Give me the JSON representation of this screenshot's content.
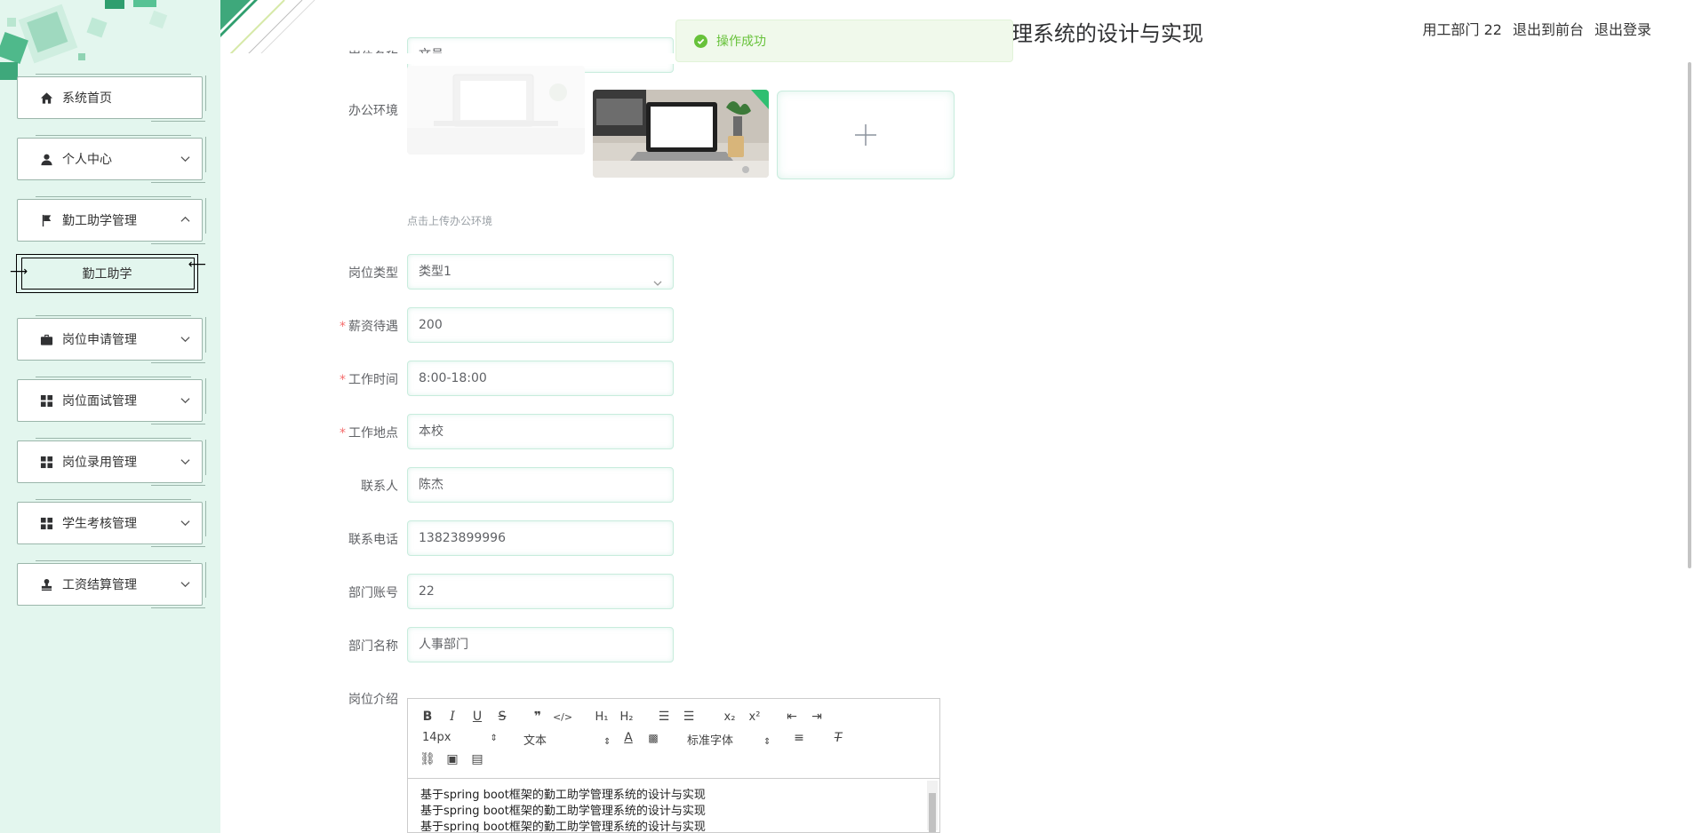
{
  "header": {
    "title": "理系统的设计与实现",
    "user": "用工部门 22",
    "to_front": "退出到前台",
    "logout": "退出登录"
  },
  "toast": {
    "message": "操作成功"
  },
  "sidebar": {
    "items": [
      {
        "label": "系统首页",
        "icon": "home-icon"
      },
      {
        "label": "个人中心",
        "icon": "user-icon"
      },
      {
        "label": "勤工助学管理",
        "icon": "flag-icon"
      },
      {
        "label": "岗位申请管理",
        "icon": "briefcase-icon"
      },
      {
        "label": "岗位面试管理",
        "icon": "grid-icon"
      },
      {
        "label": "岗位录用管理",
        "icon": "grid-icon"
      },
      {
        "label": "学生考核管理",
        "icon": "grid-icon"
      },
      {
        "label": "工资结算管理",
        "icon": "stamp-icon"
      }
    ],
    "submenu_label": "勤工助学"
  },
  "form": {
    "partial_label": "岗位名称",
    "partial_value": "文员",
    "env_label": "办公环境",
    "upload_tip": "点击上传办公环境",
    "job_type": {
      "label": "岗位类型",
      "value": "类型1"
    },
    "salary": {
      "label": "薪资待遇",
      "value": "200"
    },
    "work_time": {
      "label": "工作时间",
      "value": "8:00-18:00"
    },
    "work_place": {
      "label": "工作地点",
      "value": "本校"
    },
    "contact": {
      "label": "联系人",
      "value": "陈杰"
    },
    "phone": {
      "label": "联系电话",
      "value": "13823899996"
    },
    "dept_account": {
      "label": "部门账号",
      "value": "22"
    },
    "dept_name": {
      "label": "部门名称",
      "value": "人事部门"
    },
    "intro_label": "岗位介绍"
  },
  "editor": {
    "size": "14px",
    "header_sel": "文本",
    "font_sel": "标准字体",
    "lines": [
      "基于spring boot框架的勤工助学管理系统的设计与实现",
      "基于spring boot框架的勤工助学管理系统的设计与实现",
      "基于spring boot框架的勤工助学管理系统的设计与实现"
    ]
  },
  "colors": {
    "accent": "#67c23a",
    "sidebar_bg": "#e3f6ee",
    "border": "#c8ecdd"
  }
}
